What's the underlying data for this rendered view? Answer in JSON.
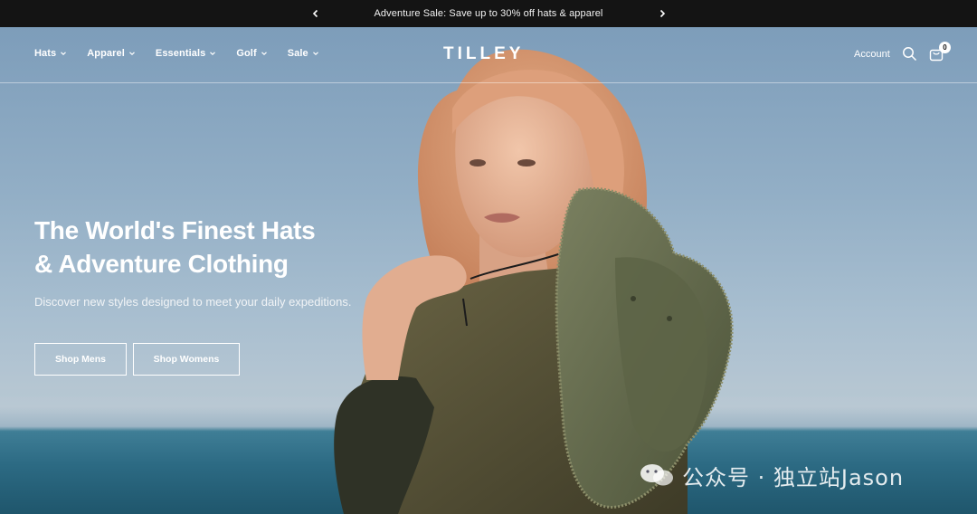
{
  "announcement": {
    "text": "Adventure Sale: Save up to 30% off hats & apparel"
  },
  "header": {
    "logo": "TILLEY",
    "nav": [
      {
        "label": "Hats"
      },
      {
        "label": "Apparel"
      },
      {
        "label": "Essentials"
      },
      {
        "label": "Golf"
      },
      {
        "label": "Sale"
      }
    ],
    "account_label": "Account",
    "cart_count": "0"
  },
  "hero": {
    "headline_line1": "The World's Finest Hats",
    "headline_line2": "& Adventure Clothing",
    "subtext": "Discover new styles designed to meet your daily expeditions.",
    "button_mens": "Shop Mens",
    "button_womens": "Shop Womens"
  },
  "watermark": {
    "text": "公众号 · 独立站Jason"
  },
  "colors": {
    "announce_bg": "#141414",
    "sky": "#93afc6",
    "sea": "#2c6a83",
    "hat_green": "#5d6447",
    "jacket_olive": "#545037",
    "hair": "#d59a77"
  }
}
